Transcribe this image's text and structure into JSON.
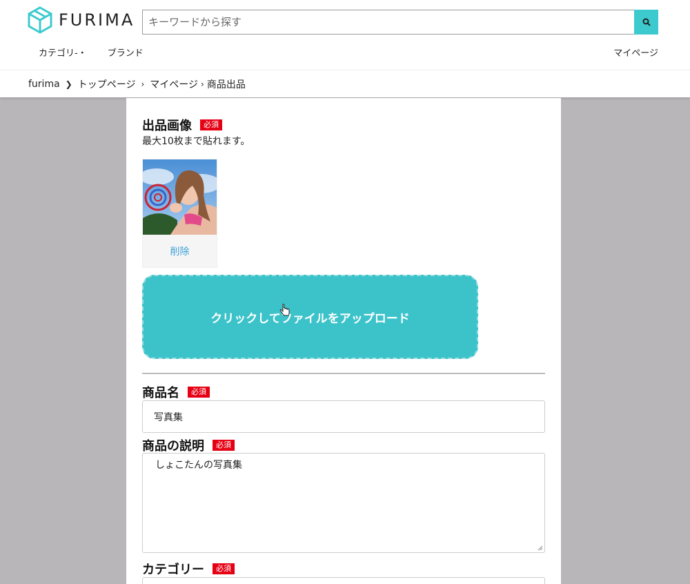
{
  "header": {
    "logo_text": "FURIMA",
    "search_placeholder": "キーワードから探す",
    "nav_left": [
      "カテゴリ-・",
      "ブランド"
    ],
    "nav_right": "マイページ"
  },
  "breadcrumb": [
    "furima",
    "トップページ",
    "マイページ",
    "商品出品"
  ],
  "form": {
    "image_section": {
      "label": "出品画像",
      "required": "必須",
      "hint": "最大10枚まで貼れます。",
      "delete_label": "削除",
      "upload_label": "クリックしてファイルをアップロード"
    },
    "name_section": {
      "label": "商品名",
      "required": "必須",
      "value": "写真集"
    },
    "description_section": {
      "label": "商品の説明",
      "required": "必須",
      "value": "しょこたんの写真集"
    },
    "category_section": {
      "label": "カテゴリー",
      "required": "必須"
    }
  },
  "colors": {
    "accent": "#3cc3ca",
    "required_badge": "#e60014",
    "link": "#3ba1d8",
    "backdrop": "#b9b6b9"
  },
  "icons": [
    "furima-logo-icon",
    "search-icon",
    "chevron-right-icon",
    "pointer-cursor-icon",
    "resize-grip-icon"
  ]
}
